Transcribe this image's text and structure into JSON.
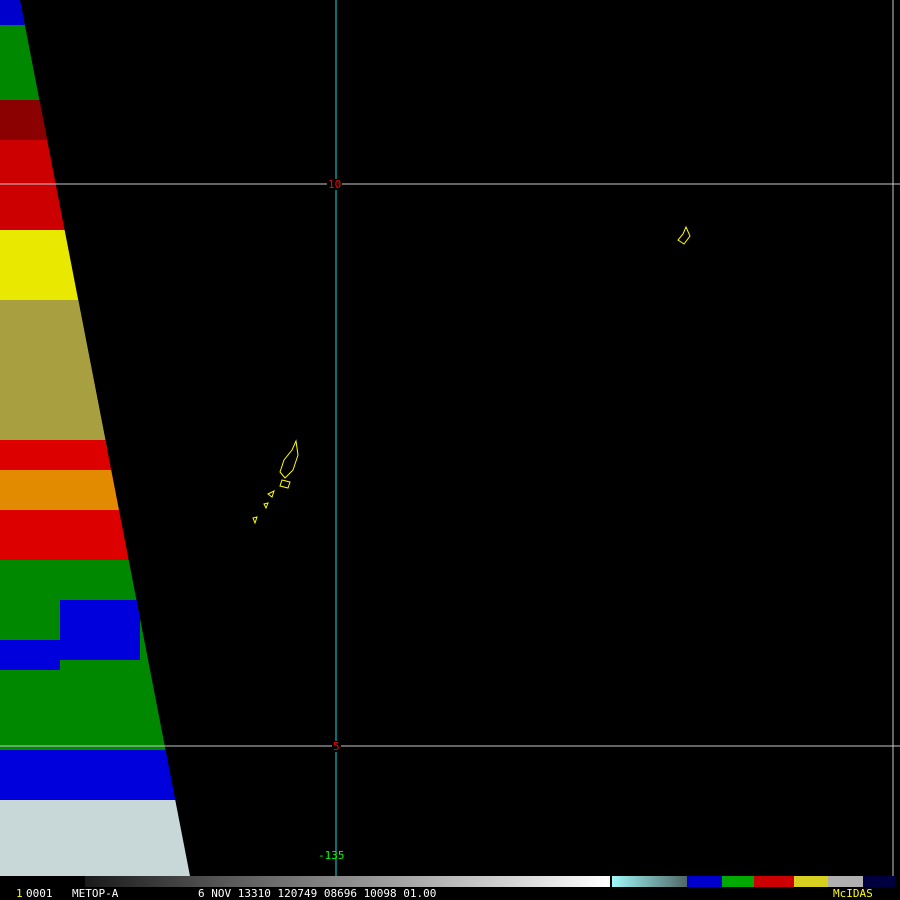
{
  "image": {
    "grid_labels": {
      "lat_top": "10",
      "lat_bottom": "5",
      "lon": "-135"
    },
    "colors": {
      "grid_lat": "#c8c8c8",
      "grid_lon": "#00e0e0",
      "coast": "#ffff00",
      "label_lat": "#ff0000",
      "label_lon": "#00ff00"
    }
  },
  "status_bar": {
    "frame_number": "1",
    "frame_id": "0001",
    "satellite": "METOP-A",
    "info": "6 NOV 13310 120749 08696 10098 01.00",
    "brand": "McIDAS"
  }
}
